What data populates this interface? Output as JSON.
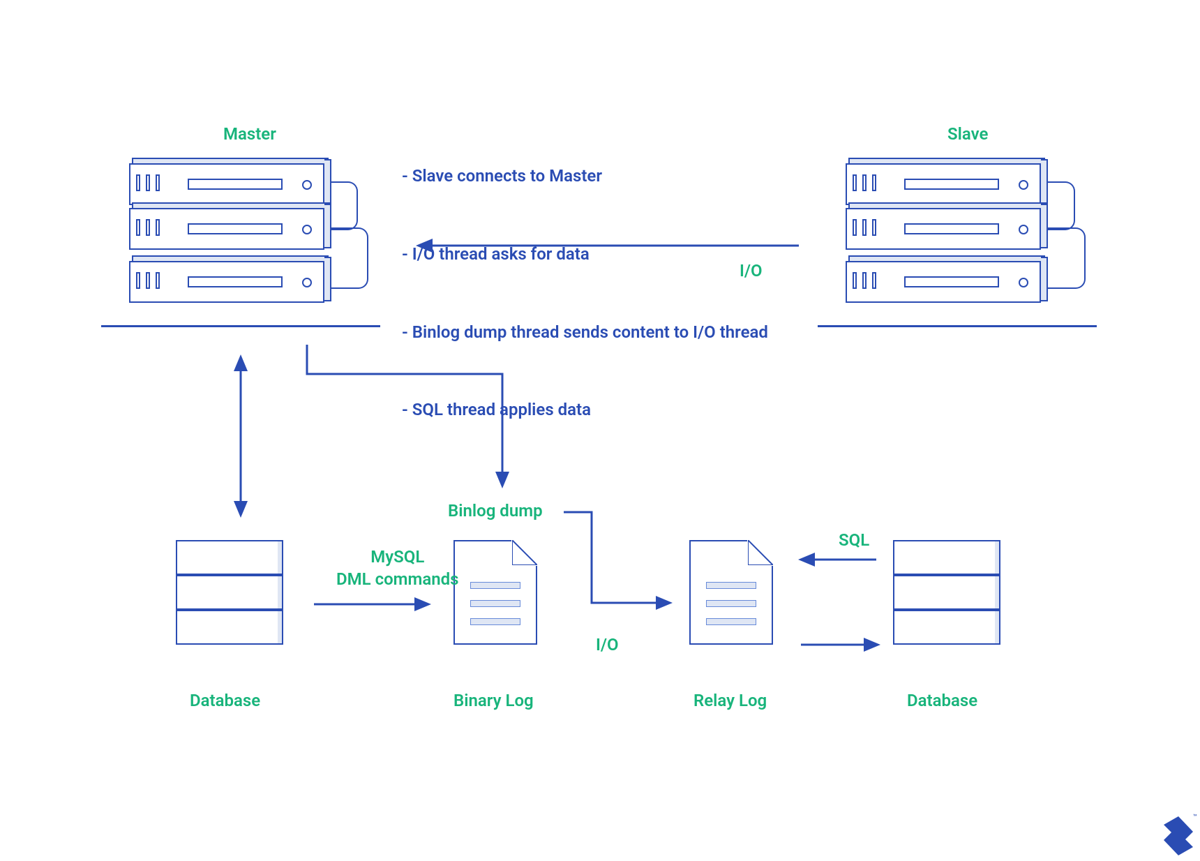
{
  "title_master": "Master",
  "title_slave": "Slave",
  "bullets": [
    "- Slave connects to Master",
    "- I/O thread asks for data",
    "- Binlog dump thread sends content to I/O thread",
    "- SQL thread applies data"
  ],
  "labels": {
    "io_top": "I/O",
    "binlog_dump": "Binlog dump",
    "mysql_dml_1": "MySQL",
    "mysql_dml_2": "DML commands",
    "io_bottom": "I/O",
    "sql": "SQL"
  },
  "captions": {
    "database_left": "Database",
    "binary_log": "Binary Log",
    "relay_log": "Relay Log",
    "database_right": "Database"
  },
  "logo": {
    "trademark": "™"
  }
}
